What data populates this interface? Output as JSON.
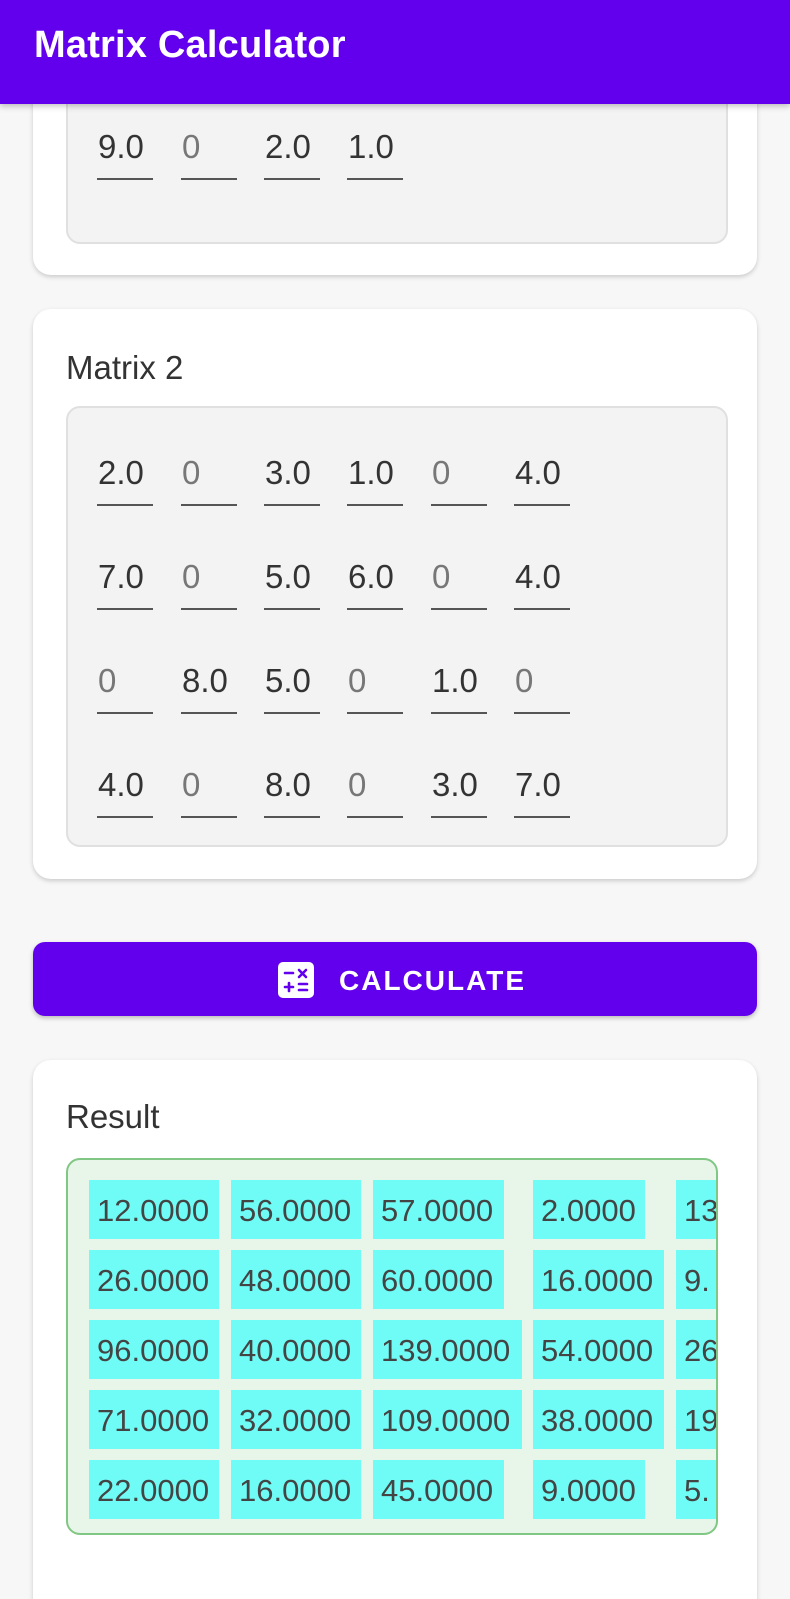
{
  "app": {
    "title": "Matrix Calculator"
  },
  "matrix1": {
    "visible_rows": [
      [
        "9.0",
        "0",
        "2.0",
        "1.0"
      ]
    ]
  },
  "matrix2": {
    "title": "Matrix 2",
    "rows": [
      [
        "2.0",
        "0",
        "3.0",
        "1.0",
        "0",
        "4.0"
      ],
      [
        "7.0",
        "0",
        "5.0",
        "6.0",
        "0",
        "4.0"
      ],
      [
        "0",
        "8.0",
        "5.0",
        "0",
        "1.0",
        "0"
      ],
      [
        "4.0",
        "0",
        "8.0",
        "0",
        "3.0",
        "7.0"
      ]
    ]
  },
  "calculate_button": {
    "label": "CALCULATE",
    "icon": "calculator-icon"
  },
  "result": {
    "title": "Result",
    "rows": [
      [
        "12.0000",
        "56.0000",
        "57.0000",
        "2.0000",
        "13"
      ],
      [
        "26.0000",
        "48.0000",
        "60.0000",
        "16.0000",
        "9."
      ],
      [
        "96.0000",
        "40.0000",
        "139.0000",
        "54.0000",
        "26"
      ],
      [
        "71.0000",
        "32.0000",
        "109.0000",
        "38.0000",
        "19"
      ],
      [
        "22.0000",
        "16.0000",
        "45.0000",
        "9.0000",
        "5."
      ]
    ]
  },
  "colors": {
    "primary": "#6200ee",
    "result_cell": "#6ffcf6",
    "result_bg": "#e8f5e9",
    "result_border": "#81c784"
  }
}
